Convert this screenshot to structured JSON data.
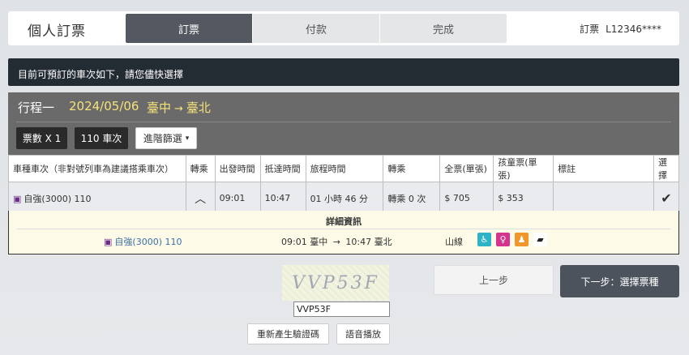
{
  "header": {
    "title": "個人訂票",
    "steps": [
      "訂票",
      "付款",
      "完成"
    ],
    "ticket_label": "訂票",
    "ticket_id": "L12346****"
  },
  "notice": "目前可預訂的車次如下，請您儘快選擇",
  "trip": {
    "label": "行程一",
    "date": "2024/05/06",
    "from": "臺中",
    "to": "臺北",
    "qty_chip": "票數 X 1",
    "train_chip": "110 車次",
    "filter_label": "進階篩選"
  },
  "table": {
    "headers": [
      "車種車次（非對號列車為建議搭乘車次）",
      "轉乘",
      "出發時間",
      "抵達時間",
      "旅程時間",
      "轉乘",
      "全票(單張)",
      "孩童票(單張)",
      "標註",
      "選擇"
    ],
    "row": {
      "train": "自強(3000) 110",
      "transfer": "",
      "depart": "09:01",
      "arrive": "10:47",
      "duration": "01 小時 46 分",
      "transfers": "轉乘 0 次",
      "adult_price": "$ 705",
      "child_price": "$ 353",
      "note": ""
    }
  },
  "detail": {
    "title": "詳細資訊",
    "train": "自強(3000) 110",
    "depart_time": "09:01",
    "from": "臺中",
    "arrive_time": "10:47",
    "to": "臺北",
    "line": "山線"
  },
  "captcha": {
    "image_text": "VVP53F",
    "input_value": "VVP53F",
    "regen_label": "重新產生驗證碼",
    "audio_label": "語音播放"
  },
  "nav": {
    "prev_label": "上一步",
    "next_label": "下一步：選擇票種"
  },
  "colors": {
    "accent_dark": "#545861",
    "trip_highlight": "#f5e27a",
    "check": "#1a7fb5"
  }
}
